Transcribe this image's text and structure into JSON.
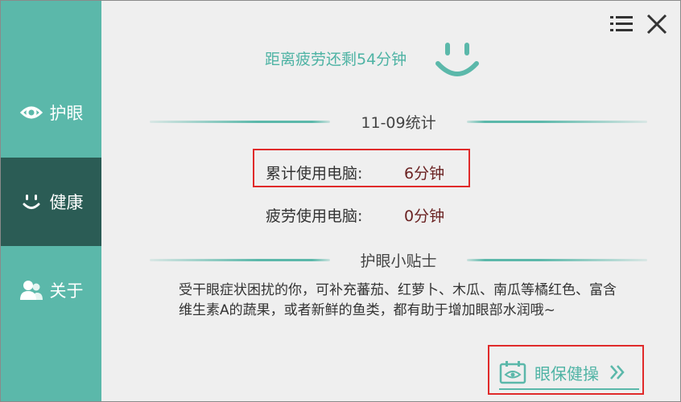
{
  "sidebar": {
    "items": [
      {
        "label": "护眼",
        "icon": "eye-target-icon",
        "active": false
      },
      {
        "label": "健康",
        "icon": "smile-icon",
        "active": true
      },
      {
        "label": "关于",
        "icon": "users-icon",
        "active": false
      }
    ]
  },
  "header": {
    "countdown": "距离疲劳还剩54分钟",
    "menu_icon": "menu-icon",
    "close_icon": "close-icon",
    "mood_icon": "smiley-icon"
  },
  "stats": {
    "title": "11-09统计",
    "total_label": "累计使用电脑:",
    "total_value": "6分钟",
    "fatigue_label": "疲劳使用电脑:",
    "fatigue_value": "0分钟"
  },
  "tips": {
    "title": "护眼小贴士",
    "text": "受干眼症状困扰的你，可补充蕃茄、红萝卜、木瓜、南瓜等橘红色、富含维生素A的蔬果，或者新鲜的鱼类，都有助于增加眼部水润哦~"
  },
  "exercise": {
    "label": "眼保健操",
    "icon": "eye-calendar-icon",
    "arrow_icon": "double-chevron-right-icon"
  },
  "colors": {
    "accent": "#5bb8aa",
    "sidebar_active": "#2b5c55",
    "highlight_border": "#e02a2a",
    "value_text": "#6b2323"
  }
}
